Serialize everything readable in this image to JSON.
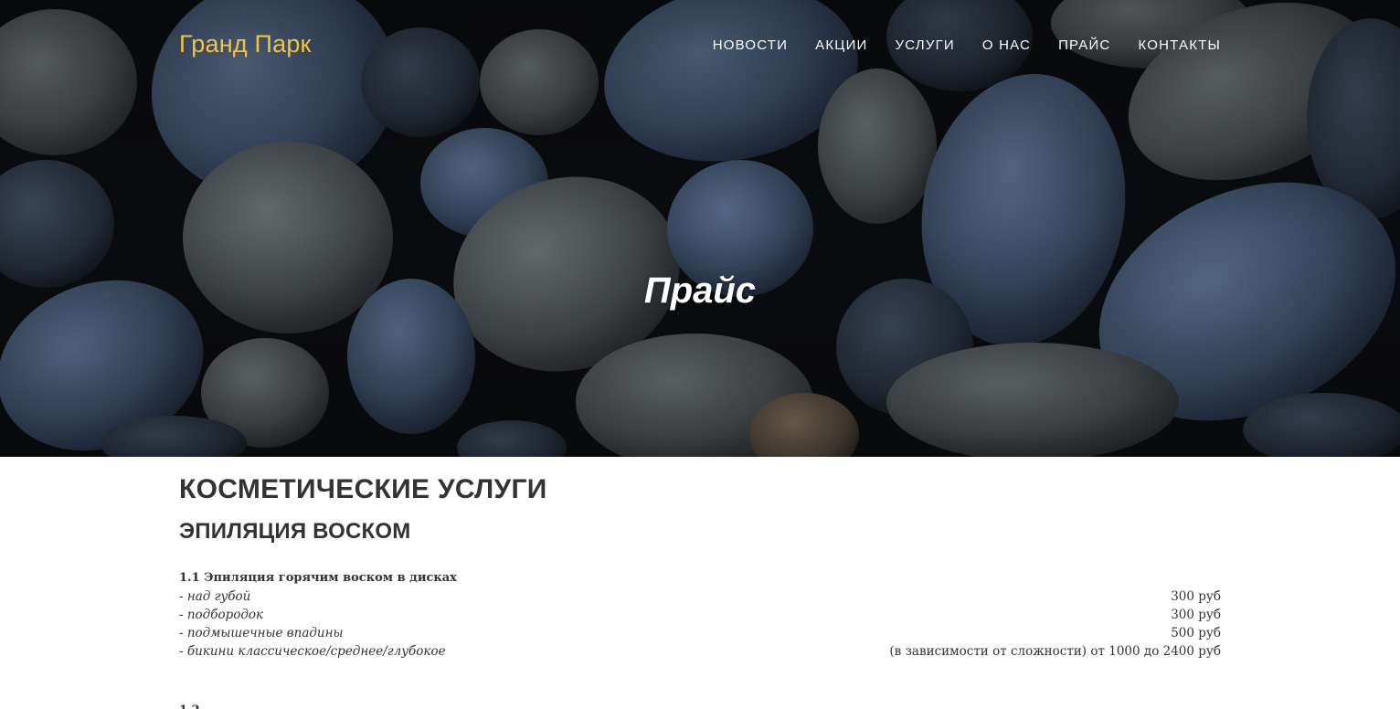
{
  "header": {
    "brand": "Гранд Парк",
    "nav": [
      "НОВОСТИ",
      "АКЦИИ",
      "УСЛУГИ",
      "О НАС",
      "ПРАЙС",
      "КОНТАКТЫ"
    ]
  },
  "hero": {
    "title": "Прайс"
  },
  "price_list": {
    "section_title": "КОСМЕТИЧЕСКИЕ УСЛУГИ",
    "subsection_title": "ЭПИЛЯЦИЯ ВОСКОМ",
    "groups": [
      {
        "title": "1.1 Эпиляция горячим воском в дисках",
        "items": [
          {
            "name": "- над губой",
            "price": "300 руб"
          },
          {
            "name": "- подбородок",
            "price": "300 руб"
          },
          {
            "name": "- подмышечные впадины",
            "price": "500 руб"
          },
          {
            "name": "- бикини классическое/среднее/глубокое",
            "price": "(в зависимости от сложности) от 1000 до 2400 руб"
          }
        ]
      }
    ],
    "next_group_title": "1.2"
  },
  "colors": {
    "brand": "#f0c443",
    "text": "#333333",
    "hero_bg": "#0c0d10"
  }
}
